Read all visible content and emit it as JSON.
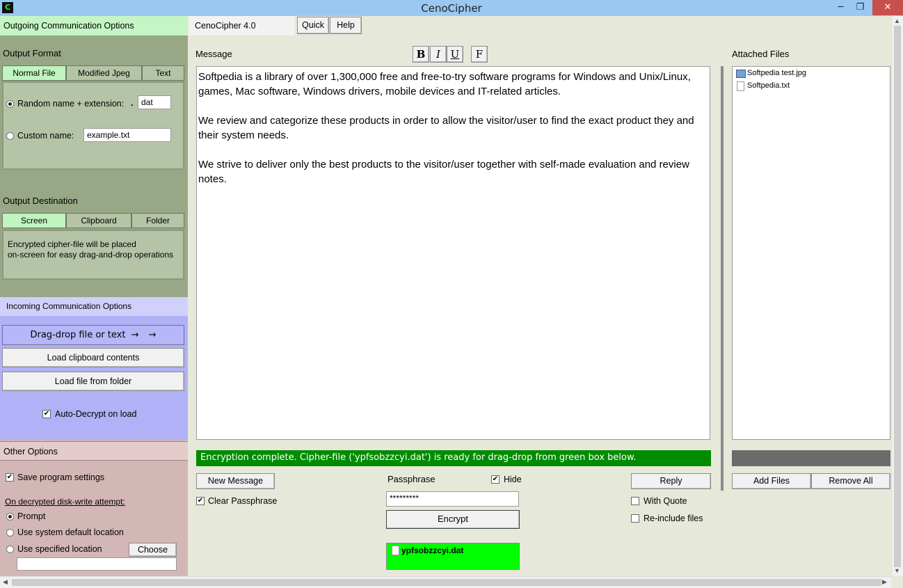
{
  "window": {
    "title": "CenoCipher",
    "minimize": "─",
    "maximize": "❐",
    "close": "✕"
  },
  "outgoing": {
    "header": "Outgoing Communication Options",
    "output_format": {
      "title": "Output Format",
      "tabs": [
        "Normal File",
        "Modified Jpeg",
        "Text"
      ],
      "random_name_label": "Random name + extension:",
      "dot": ".",
      "extension_value": "dat",
      "custom_name_label": "Custom name:",
      "custom_name_value": "example.txt"
    },
    "output_destination": {
      "title": "Output Destination",
      "tabs": [
        "Screen",
        "Clipboard",
        "Folder"
      ],
      "description_line1": "Encrypted cipher-file will be placed",
      "description_line2": "on-screen for easy drag-and-drop operations"
    }
  },
  "incoming": {
    "header": "Incoming Communication Options",
    "drag_drop_label": "Drag-drop file or text",
    "drag_drop_arrow": "→",
    "load_clipboard_label": "Load clipboard contents",
    "load_folder_label": "Load file from folder",
    "auto_decrypt_label": "Auto-Decrypt on load"
  },
  "other": {
    "header": "Other Options",
    "save_settings_label": "Save program settings",
    "disk_write_label": "On decrypted disk-write attempt:",
    "prompt_label": "Prompt",
    "system_default_label": "Use system default location",
    "specified_label": "Use specified location",
    "choose_label": "Choose"
  },
  "toolbar": {
    "app_version": "CenoCipher 4.0",
    "quick_label": "Quick",
    "help_label": "Help",
    "bold": "B",
    "italic": "I",
    "underline": "U",
    "font": "F"
  },
  "message": {
    "title": "Message",
    "paragraphs": [
      "Softpedia is a library of over 1,300,000 free and free-to-try software programs for Windows and Unix/Linux, games, Mac software, Windows drivers, mobile devices and IT-related articles.",
      "We review and categorize these products in order to allow the visitor/user to find the exact product they and their system needs.",
      "We strive to deliver only the best products to the visitor/user together with self-made evaluation and review notes."
    ],
    "status": "Encryption complete. Cipher-file ('ypfsobzzcyi.dat') is ready for drag-drop from green box below."
  },
  "controls": {
    "new_message_label": "New Message",
    "clear_passphrase_label": "Clear Passphrase",
    "passphrase_label": "Passphrase",
    "hide_label": "Hide",
    "passphrase_value": "*********",
    "encrypt_label": "Encrypt",
    "output_file": "ypfsobzzcyi.dat",
    "reply_label": "Reply",
    "with_quote_label": "With Quote",
    "reinclude_label": "Re-include files"
  },
  "attachments": {
    "title": "Attached Files",
    "files": [
      "Softpedia test.jpg",
      "Softpedia.txt"
    ],
    "add_label": "Add Files",
    "remove_label": "Remove All"
  },
  "colors": {
    "status_bg": "#008c00",
    "output_box": "#00ff00",
    "outgoing_header": "#c5f5c5",
    "incoming_bg": "#b1b1f7",
    "other_bg": "#d3b6b6"
  }
}
